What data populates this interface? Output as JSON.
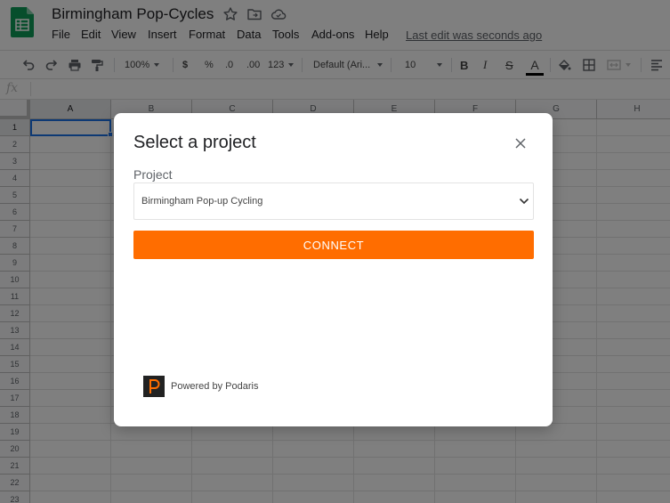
{
  "doc": {
    "title": "Birmingham Pop-Cycles",
    "last_edit": "Last edit was seconds ago"
  },
  "menu": [
    "File",
    "Edit",
    "View",
    "Insert",
    "Format",
    "Data",
    "Tools",
    "Add-ons",
    "Help"
  ],
  "toolbar": {
    "zoom": "100%",
    "currency": "$",
    "percent": "%",
    "decrease_decimals": ".0",
    "increase_decimals": ".00",
    "more_formats": "123",
    "font_family": "Default (Ari...",
    "font_size": "10",
    "bold": "B",
    "italic": "I",
    "strikethrough": "S",
    "text_color": "A"
  },
  "formula_bar": {
    "fx": "fx",
    "value": ""
  },
  "grid": {
    "columns": [
      "A",
      "B",
      "C",
      "D",
      "E",
      "F",
      "G",
      "H"
    ],
    "rows": [
      "1",
      "2",
      "3",
      "4",
      "5",
      "6",
      "7",
      "8",
      "9",
      "10",
      "11",
      "12",
      "13",
      "14",
      "15",
      "16",
      "17",
      "18",
      "19",
      "20",
      "21",
      "22",
      "23"
    ],
    "active_cell": "A1"
  },
  "dialog": {
    "title": "Select a project",
    "field_label": "Project",
    "selected_project": "Birmingham Pop-up Cycling",
    "connect_label": "CONNECT",
    "powered_by": "Powered by Podaris"
  },
  "colors": {
    "accent": "#ff6d00",
    "sheets_green": "#0f9d58",
    "selection_blue": "#1a73e8"
  },
  "icons": [
    "sheets-logo-icon",
    "star-icon",
    "move-folder-icon",
    "cloud-saved-icon",
    "undo-icon",
    "redo-icon",
    "print-icon",
    "paint-format-icon",
    "fill-color-icon",
    "borders-icon",
    "merge-cells-icon",
    "align-left-icon",
    "close-icon",
    "chevron-down-icon",
    "podaris-logo-icon"
  ]
}
